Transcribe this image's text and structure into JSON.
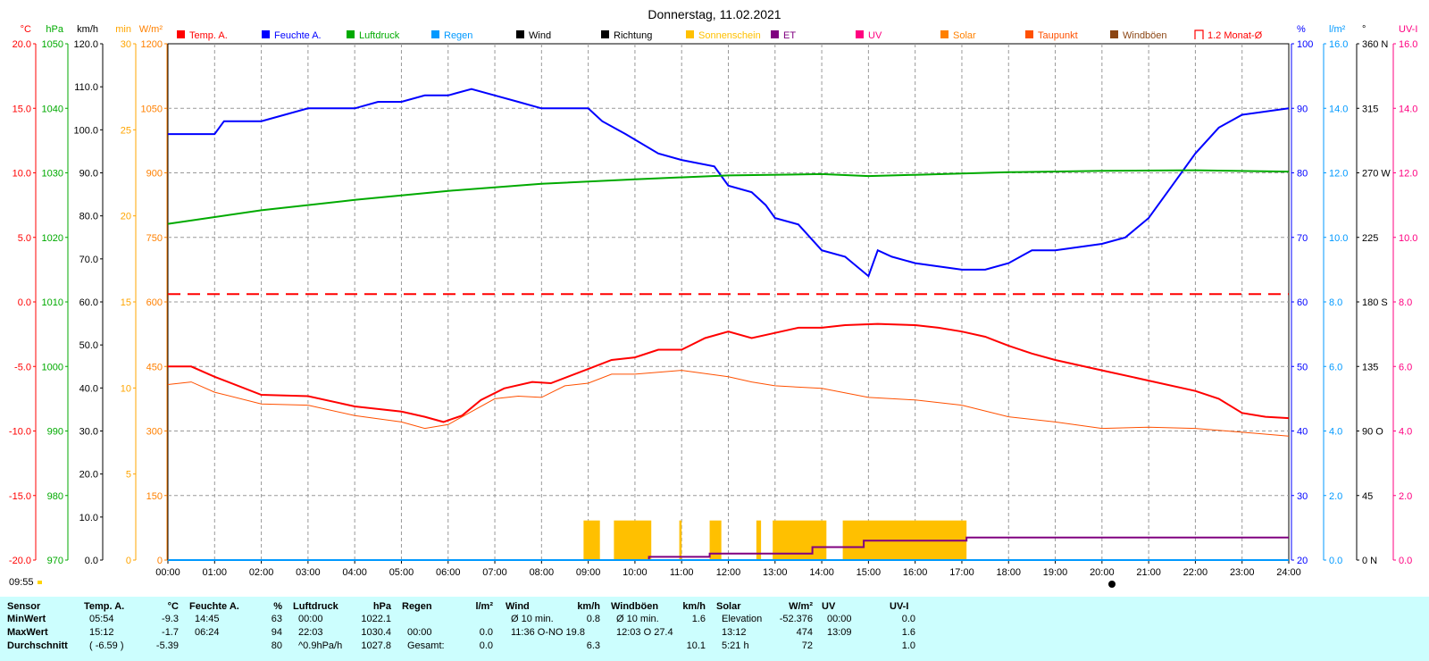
{
  "title": "Donnerstag, 11.02.2021",
  "time_indicator": "09:55",
  "legend": [
    {
      "label": "Temp. A.",
      "color": "#ff0000",
      "kind": "box"
    },
    {
      "label": "Feuchte A.",
      "color": "#0000ff",
      "kind": "box"
    },
    {
      "label": "Luftdruck",
      "color": "#00aa00",
      "kind": "box"
    },
    {
      "label": "Regen",
      "color": "#0099ff",
      "kind": "box"
    },
    {
      "label": "Wind",
      "color": "#000000",
      "kind": "box"
    },
    {
      "label": "Richtung",
      "color": "#000000",
      "kind": "box"
    },
    {
      "label": "Sonnenschein",
      "color": "#ffc000",
      "kind": "box"
    },
    {
      "label": "ET",
      "color": "#800080",
      "kind": "box"
    },
    {
      "label": "UV",
      "color": "#ff0080",
      "kind": "box"
    },
    {
      "label": "Solar",
      "color": "#ff8000",
      "kind": "box"
    },
    {
      "label": "Taupunkt",
      "color": "#ff5000",
      "kind": "box"
    },
    {
      "label": "Windböen",
      "color": "#8b4513",
      "kind": "box"
    },
    {
      "label": "1.2 Monat-Ø",
      "color": "#ff0000",
      "kind": "outline"
    }
  ],
  "axes": {
    "temp": {
      "unit": "°C",
      "color": "#ff0000",
      "ticks": [
        "20.0",
        "15.0",
        "10.0",
        "5.0",
        "0.0",
        "-5.0",
        "-10.0",
        "-15.0",
        "-20.0"
      ]
    },
    "hpa": {
      "unit": "hPa",
      "color": "#00aa00",
      "ticks": [
        "1050",
        "1040",
        "1030",
        "1020",
        "1010",
        "1000",
        "990",
        "980",
        "970"
      ]
    },
    "kmh": {
      "unit": "km/h",
      "color": "#000000",
      "ticks": [
        "120.0",
        "110.0",
        "100.0",
        "90.0",
        "80.0",
        "70.0",
        "60.0",
        "50.0",
        "40.0",
        "30.0",
        "20.0",
        "10.0",
        "0.0"
      ]
    },
    "min": {
      "unit": "min",
      "color": "#ffa500",
      "ticks": [
        "30",
        "25",
        "20",
        "15",
        "10",
        "5",
        "0"
      ]
    },
    "wm2": {
      "unit": "W/m²",
      "color": "#ff8000",
      "ticks": [
        "1200",
        "1050",
        "900",
        "750",
        "600",
        "450",
        "300",
        "150",
        "0"
      ]
    },
    "pct": {
      "unit": "%",
      "color": "#0000ff",
      "ticks": [
        "100",
        "90",
        "80",
        "70",
        "60",
        "50",
        "40",
        "30",
        "20"
      ]
    },
    "lm2": {
      "unit": "l/m²",
      "color": "#0099ff",
      "ticks": [
        "16.0",
        "14.0",
        "12.0",
        "10.0",
        "8.0",
        "6.0",
        "4.0",
        "2.0",
        "0.0"
      ]
    },
    "deg": {
      "unit": "°",
      "color": "#000000",
      "ticks": [
        "360 N",
        "315",
        "270 W",
        "225",
        "180 S",
        "135",
        "90 O",
        "45",
        "0 N"
      ]
    },
    "uvi": {
      "unit": "UV-I",
      "color": "#ff0080",
      "ticks": [
        "16.0",
        "14.0",
        "12.0",
        "10.0",
        "8.0",
        "6.0",
        "4.0",
        "2.0",
        "0.0"
      ]
    }
  },
  "x_ticks": [
    "00:00",
    "01:00",
    "02:00",
    "03:00",
    "04:00",
    "05:00",
    "06:00",
    "07:00",
    "08:00",
    "09:00",
    "10:00",
    "11:00",
    "12:00",
    "13:00",
    "14:00",
    "15:00",
    "16:00",
    "17:00",
    "18:00",
    "19:00",
    "20:00",
    "21:00",
    "22:00",
    "23:00",
    "24:00"
  ],
  "chart_data": {
    "type": "line",
    "title": "Donnerstag, 11.02.2021",
    "x_unit": "hour of day",
    "xlim": [
      0,
      24
    ],
    "grid": true,
    "series": [
      {
        "name": "Temp. A.",
        "unit": "°C",
        "color": "#ff0000",
        "points": [
          [
            0,
            -5.0
          ],
          [
            0.5,
            -5.0
          ],
          [
            1,
            -5.8
          ],
          [
            2,
            -7.2
          ],
          [
            3,
            -7.3
          ],
          [
            4,
            -8.1
          ],
          [
            5,
            -8.5
          ],
          [
            5.5,
            -8.9
          ],
          [
            5.9,
            -9.3
          ],
          [
            6.3,
            -8.8
          ],
          [
            6.7,
            -7.6
          ],
          [
            7.2,
            -6.7
          ],
          [
            7.8,
            -6.2
          ],
          [
            8.2,
            -6.3
          ],
          [
            9,
            -5.2
          ],
          [
            9.5,
            -4.5
          ],
          [
            10,
            -4.3
          ],
          [
            10.5,
            -3.7
          ],
          [
            11,
            -3.7
          ],
          [
            11.5,
            -2.8
          ],
          [
            12,
            -2.3
          ],
          [
            12.5,
            -2.8
          ],
          [
            13,
            -2.4
          ],
          [
            13.5,
            -2.0
          ],
          [
            14,
            -2.0
          ],
          [
            14.5,
            -1.8
          ],
          [
            15.2,
            -1.7
          ],
          [
            16,
            -1.8
          ],
          [
            16.5,
            -2.0
          ],
          [
            17,
            -2.3
          ],
          [
            17.5,
            -2.7
          ],
          [
            18,
            -3.4
          ],
          [
            18.5,
            -4.0
          ],
          [
            19,
            -4.5
          ],
          [
            20,
            -5.3
          ],
          [
            21,
            -6.1
          ],
          [
            22,
            -6.9
          ],
          [
            22.5,
            -7.5
          ],
          [
            23,
            -8.6
          ],
          [
            23.5,
            -8.9
          ],
          [
            24,
            -9.0
          ]
        ]
      },
      {
        "name": "Taupunkt",
        "unit": "°C",
        "color": "#ff5000",
        "points": [
          [
            0,
            -6.4
          ],
          [
            0.5,
            -6.2
          ],
          [
            1,
            -7.0
          ],
          [
            2,
            -7.9
          ],
          [
            3,
            -8.0
          ],
          [
            4,
            -8.8
          ],
          [
            5,
            -9.3
          ],
          [
            5.5,
            -9.8
          ],
          [
            6,
            -9.5
          ],
          [
            6.5,
            -8.5
          ],
          [
            7,
            -7.5
          ],
          [
            7.5,
            -7.3
          ],
          [
            8,
            -7.4
          ],
          [
            8.5,
            -6.5
          ],
          [
            9,
            -6.3
          ],
          [
            9.5,
            -5.6
          ],
          [
            10,
            -5.6
          ],
          [
            11,
            -5.3
          ],
          [
            12,
            -5.8
          ],
          [
            12.5,
            -6.2
          ],
          [
            13,
            -6.5
          ],
          [
            14,
            -6.7
          ],
          [
            15,
            -7.4
          ],
          [
            16,
            -7.6
          ],
          [
            17,
            -8.0
          ],
          [
            18,
            -8.9
          ],
          [
            19,
            -9.3
          ],
          [
            20,
            -9.8
          ],
          [
            21,
            -9.7
          ],
          [
            22,
            -9.8
          ],
          [
            23,
            -10.1
          ],
          [
            24,
            -10.4
          ]
        ]
      },
      {
        "name": "Feuchte A.",
        "unit": "%",
        "color": "#0000ff",
        "points": [
          [
            0,
            86
          ],
          [
            1,
            86
          ],
          [
            1.2,
            88
          ],
          [
            2,
            88
          ],
          [
            2.5,
            89
          ],
          [
            3,
            90
          ],
          [
            4,
            90
          ],
          [
            4.5,
            91
          ],
          [
            5,
            91
          ],
          [
            5.5,
            92
          ],
          [
            6,
            92
          ],
          [
            6.5,
            93
          ],
          [
            7,
            92
          ],
          [
            7.5,
            91
          ],
          [
            8,
            90
          ],
          [
            9,
            90
          ],
          [
            9.3,
            88
          ],
          [
            9.8,
            86
          ],
          [
            10.5,
            83
          ],
          [
            11,
            82
          ],
          [
            11.7,
            81
          ],
          [
            12,
            78
          ],
          [
            12.5,
            77
          ],
          [
            12.8,
            75
          ],
          [
            13,
            73
          ],
          [
            13.5,
            72
          ],
          [
            14,
            68
          ],
          [
            14.5,
            67
          ],
          [
            15,
            64
          ],
          [
            15.2,
            68
          ],
          [
            15.5,
            67
          ],
          [
            16,
            66
          ],
          [
            17,
            65
          ],
          [
            17.5,
            65
          ],
          [
            18,
            66
          ],
          [
            18.5,
            68
          ],
          [
            19,
            68
          ],
          [
            20,
            69
          ],
          [
            20.5,
            70
          ],
          [
            21,
            73
          ],
          [
            21.5,
            78
          ],
          [
            22,
            83
          ],
          [
            22.5,
            87
          ],
          [
            23,
            89
          ],
          [
            24,
            90
          ]
        ]
      },
      {
        "name": "Luftdruck",
        "unit": "hPa",
        "color": "#00aa00",
        "points": [
          [
            0,
            1022.1
          ],
          [
            2,
            1024.2
          ],
          [
            4,
            1025.8
          ],
          [
            6,
            1027.2
          ],
          [
            8,
            1028.3
          ],
          [
            10,
            1029.0
          ],
          [
            12,
            1029.6
          ],
          [
            14,
            1029.8
          ],
          [
            15,
            1029.5
          ],
          [
            16,
            1029.7
          ],
          [
            18,
            1030.1
          ],
          [
            20,
            1030.3
          ],
          [
            22,
            1030.4
          ],
          [
            24,
            1030.2
          ]
        ]
      },
      {
        "name": "Sonnenschein",
        "unit": "min",
        "color": "#ffc000",
        "bars": [
          [
            8.9,
            9.25,
            2.3
          ],
          [
            9.55,
            10.35,
            2.3
          ],
          [
            10.95,
            11.0,
            2.3
          ],
          [
            11.6,
            11.85,
            2.3
          ],
          [
            12.6,
            12.7,
            2.3
          ],
          [
            12.95,
            14.1,
            2.3
          ],
          [
            14.45,
            17.1,
            2.3
          ]
        ]
      },
      {
        "name": "ET",
        "unit": "l/m²",
        "color": "#800080",
        "points": [
          [
            0,
            0
          ],
          [
            10.3,
            0
          ],
          [
            10.3,
            0.1
          ],
          [
            11.6,
            0.1
          ],
          [
            11.6,
            0.2
          ],
          [
            13.8,
            0.2
          ],
          [
            13.8,
            0.4
          ],
          [
            14.9,
            0.4
          ],
          [
            14.9,
            0.6
          ],
          [
            17.1,
            0.6
          ],
          [
            17.1,
            0.7
          ],
          [
            24,
            0.7
          ]
        ]
      },
      {
        "name": "Regen",
        "unit": "l/m²",
        "color": "#0099ff",
        "points": [
          [
            0,
            0
          ],
          [
            24,
            0
          ]
        ]
      },
      {
        "name": "1.2 Monat-Ø",
        "unit": "°C",
        "color": "#ff0000",
        "dashed": true,
        "points": [
          [
            0,
            0.6
          ],
          [
            24,
            0.6
          ]
        ]
      }
    ]
  },
  "stats": {
    "row_labels": [
      "Sensor",
      "MinWert",
      "MaxWert",
      "Durchschnitt"
    ],
    "groups": [
      {
        "name": "Temp. A.",
        "unit": "°C",
        "rows": [
          [
            "05:54",
            "-9.3"
          ],
          [
            "15:12",
            "-1.7"
          ],
          [
            "( -6.59 )",
            "-5.39"
          ]
        ]
      },
      {
        "name": "Feuchte A.",
        "unit": "%",
        "rows": [
          [
            "14:45",
            "63"
          ],
          [
            "06:24",
            "94"
          ],
          [
            "",
            "80"
          ]
        ]
      },
      {
        "name": "Luftdruck",
        "unit": "hPa",
        "rows": [
          [
            "00:00",
            "1022.1"
          ],
          [
            "22:03",
            "1030.4"
          ],
          [
            "^0.9hPa/h",
            "1027.8"
          ]
        ]
      },
      {
        "name": "Regen",
        "unit": "l/m²",
        "rows": [
          [
            "",
            ""
          ],
          [
            "00:00",
            "0.0"
          ],
          [
            "Gesamt:",
            "0.0"
          ]
        ]
      },
      {
        "name": "Wind",
        "unit": "km/h",
        "rows": [
          [
            "Ø 10 min.",
            "0.8"
          ],
          [
            "11:36   O-NO 19.8",
            ""
          ],
          [
            "",
            "6.3"
          ]
        ]
      },
      {
        "name": "Windböen",
        "unit": "km/h",
        "rows": [
          [
            "Ø 10 min.",
            "1.6"
          ],
          [
            "12:03    O 27.4",
            ""
          ],
          [
            "",
            "10.1"
          ]
        ]
      },
      {
        "name": "Solar",
        "unit": "W/m²",
        "rows": [
          [
            "Elevation",
            "-52.376"
          ],
          [
            "13:12",
            "474"
          ],
          [
            "5:21 h",
            "72"
          ]
        ]
      },
      {
        "name": "UV",
        "unit": "",
        "rows": [
          [
            "00:00",
            ""
          ],
          [
            "13:09",
            ""
          ],
          [
            "",
            ""
          ]
        ]
      },
      {
        "name": "UV-I",
        "unit": "",
        "rows": [
          [
            "",
            "0.0"
          ],
          [
            "",
            "1.6"
          ],
          [
            "",
            "1.0"
          ]
        ]
      }
    ]
  }
}
